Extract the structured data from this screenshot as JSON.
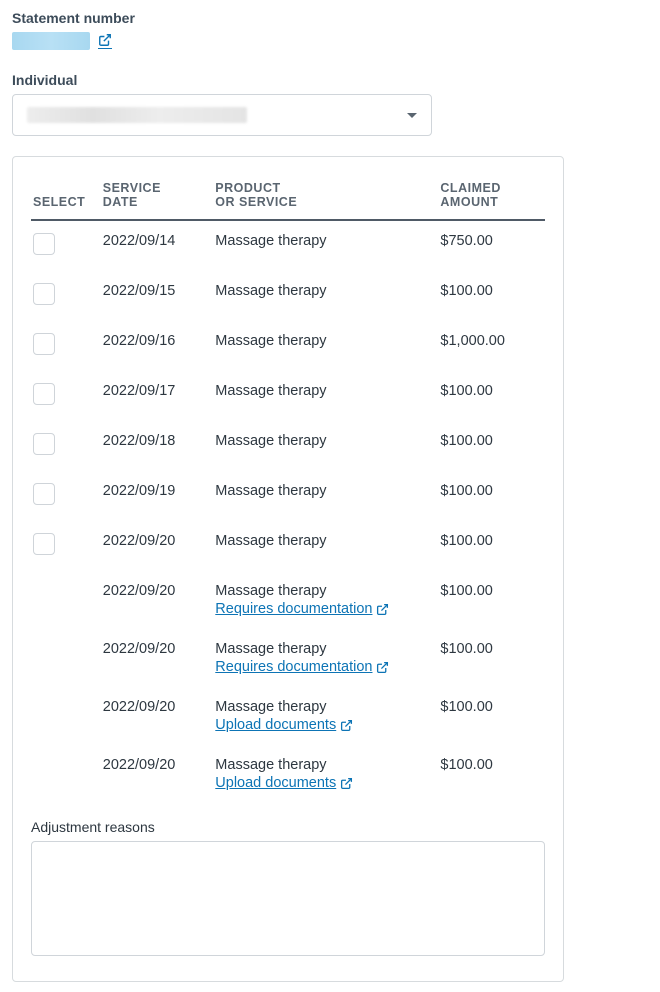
{
  "statement": {
    "label": "Statement number"
  },
  "individual": {
    "label": "Individual"
  },
  "table": {
    "headers": {
      "select": "SELECT",
      "service_date_l1": "SERVICE",
      "service_date_l2": "DATE",
      "product_l1": "PRODUCT",
      "product_l2": "OR SERVICE",
      "claimed_l1": "CLAIMED",
      "claimed_l2": "AMOUNT"
    },
    "links": {
      "requires_doc": "Requires documentation",
      "upload_doc": "Upload documents"
    },
    "rows": [
      {
        "selectable": true,
        "date": "2022/09/14",
        "product": "Massage therapy",
        "amount": "$750.00",
        "sublink": null
      },
      {
        "selectable": true,
        "date": "2022/09/15",
        "product": "Massage therapy",
        "amount": "$100.00",
        "sublink": null
      },
      {
        "selectable": true,
        "date": "2022/09/16",
        "product": "Massage therapy",
        "amount": "$1,000.00",
        "sublink": null
      },
      {
        "selectable": true,
        "date": "2022/09/17",
        "product": "Massage therapy",
        "amount": "$100.00",
        "sublink": null
      },
      {
        "selectable": true,
        "date": "2022/09/18",
        "product": "Massage therapy",
        "amount": "$100.00",
        "sublink": null
      },
      {
        "selectable": true,
        "date": "2022/09/19",
        "product": "Massage therapy",
        "amount": "$100.00",
        "sublink": null
      },
      {
        "selectable": true,
        "date": "2022/09/20",
        "product": "Massage therapy",
        "amount": "$100.00",
        "sublink": null
      },
      {
        "selectable": false,
        "date": "2022/09/20",
        "product": "Massage therapy",
        "amount": "$100.00",
        "sublink": "requires_doc"
      },
      {
        "selectable": false,
        "date": "2022/09/20",
        "product": "Massage therapy",
        "amount": "$100.00",
        "sublink": "requires_doc"
      },
      {
        "selectable": false,
        "date": "2022/09/20",
        "product": "Massage therapy",
        "amount": "$100.00",
        "sublink": "upload_doc"
      },
      {
        "selectable": false,
        "date": "2022/09/20",
        "product": "Massage therapy",
        "amount": "$100.00",
        "sublink": "upload_doc"
      }
    ]
  },
  "adjustment": {
    "label": "Adjustment reasons"
  }
}
